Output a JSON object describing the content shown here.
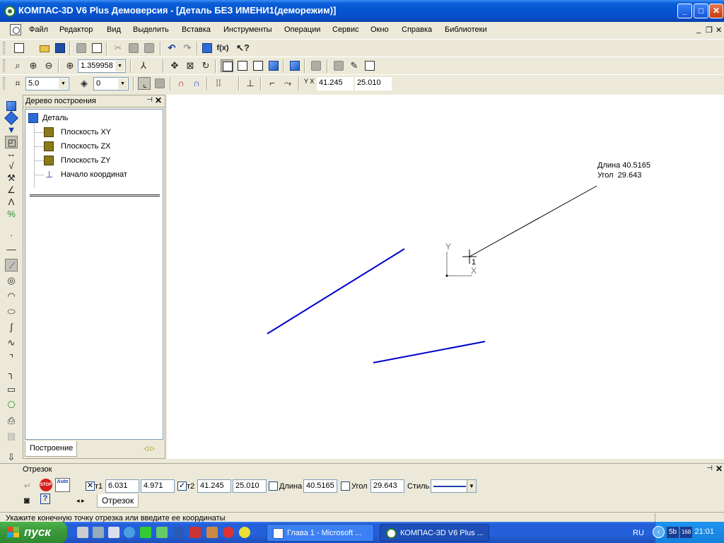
{
  "window": {
    "title": "КОМПАС-3D V6 Plus Демоверсия - [Деталь БЕЗ ИМЕНИ1(деморежим)]",
    "min_label": "_",
    "max_label": "□",
    "close_label": "✕"
  },
  "menu": {
    "items": [
      "Файл",
      "Редактор",
      "Вид",
      "Выделить",
      "Вставка",
      "Инструменты",
      "Операции",
      "Сервис",
      "Окно",
      "Справка",
      "Библиотеки"
    ],
    "mdi_min": "_",
    "mdi_restore": "❐",
    "mdi_close": "✕"
  },
  "toolbar_view": {
    "zoom_value": "1.359958"
  },
  "toolbar_current": {
    "step_value": "5.0",
    "layer_value": "0",
    "coord_label": "Y X",
    "coord_x": "41.245",
    "coord_y": "25.010"
  },
  "tree": {
    "header": "Дерево построения",
    "pin": "ᵖ",
    "close": "✕",
    "root": "Деталь",
    "items": [
      "Плоскость XY",
      "Плоскость ZX",
      "Плоскость ZY",
      "Начало координат"
    ],
    "tab": "Построение"
  },
  "canvas": {
    "tooltip_length": "Длина 40.5165",
    "tooltip_angle": "Угол  29.643",
    "axis_y": "Y",
    "axis_x": "X",
    "point_label": "1",
    "segment_color": "#0000cc"
  },
  "properties": {
    "title": "Отрезок",
    "t1_label": "т1",
    "t1_x": "6.031",
    "t1_y": "4.971",
    "t2_label": "т2",
    "t2_x": "41.245",
    "t2_y": "25.010",
    "length_label": "Длина",
    "length_value": "40.5165",
    "angle_label": "Угол",
    "angle_value": "29.643",
    "style_label": "Стиль",
    "tab": "Отрезок",
    "check_mark": "✓",
    "cross_mark": "✕",
    "stop_label": "STOP",
    "auto_label": "Auto"
  },
  "status": {
    "message": "Укажите конечную точку отрезка или введите ее координаты"
  },
  "taskbar": {
    "start_label": "пуск",
    "tasks": [
      "Глава 1 - Microsoft ...",
      "КОМПАС-3D V6 Plus ..."
    ],
    "lang": "RU",
    "tray_badge1": "5b",
    "tray_badge2": "168",
    "clock": "21:01"
  }
}
